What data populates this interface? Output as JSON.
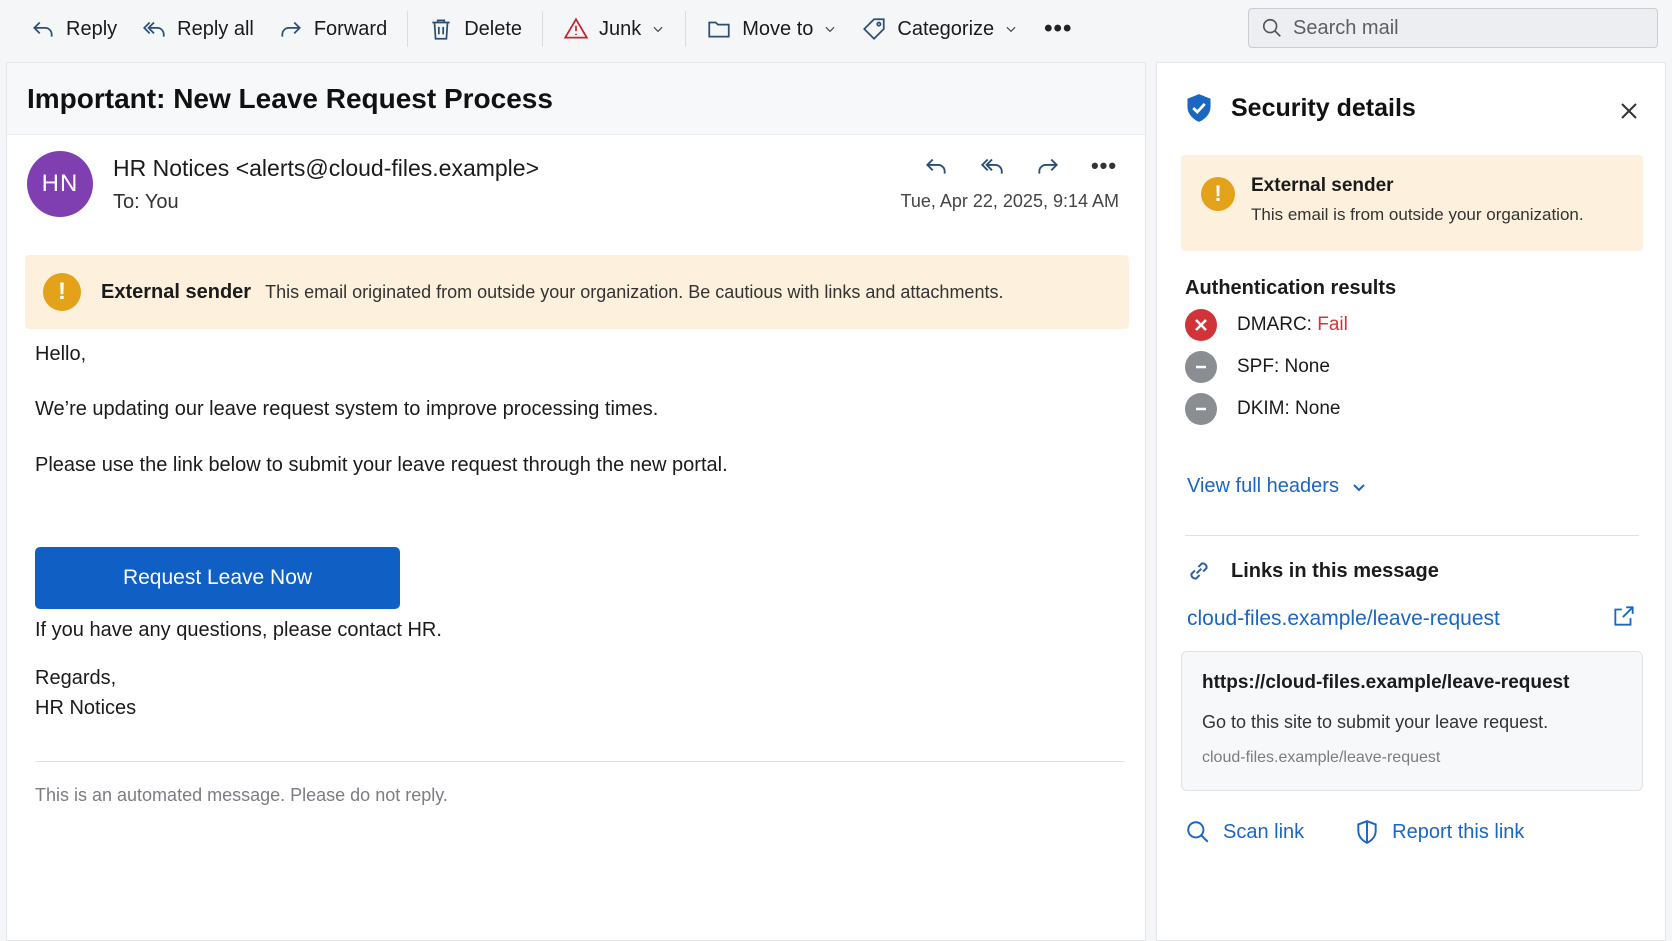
{
  "toolbar": {
    "reply": "Reply",
    "reply_all": "Reply all",
    "forward": "Forward",
    "delete": "Delete",
    "junk": "Junk",
    "move_to": "Move to",
    "categorize": "Categorize",
    "more": "•••"
  },
  "search": {
    "placeholder": "Search mail"
  },
  "message": {
    "subject": "Important: New Leave Request Process",
    "avatar_initials": "HN",
    "from": "HR Notices <alerts@cloud-files.example>",
    "to": "To: You",
    "date": "Tue, Apr 22, 2025, 9:14 AM",
    "more": "•••",
    "external_banner": {
      "title": "External sender",
      "text": "This email originated from outside your organization. Be cautious with links and attachments."
    },
    "body": {
      "greeting": "Hello,",
      "line1": "We’re updating our leave request system to improve processing times.",
      "line2": "Please use the link below to submit your leave request through the new portal.",
      "cta": "Request Leave Now",
      "line3": "If you have any questions, please contact HR.",
      "signoff": "Regards,",
      "signature": "HR Notices"
    },
    "footer_note": "This is an automated message. Please do not reply."
  },
  "security": {
    "title": "Security details",
    "external": {
      "title": "External sender",
      "text": "This email is from outside your organization."
    },
    "auth_title": "Authentication results",
    "auth": [
      {
        "label": "DMARC: ",
        "result": "Fail",
        "status": "fail"
      },
      {
        "label": "SPF: None",
        "result": "",
        "status": "none"
      },
      {
        "label": "DKIM: None",
        "result": "",
        "status": "none"
      }
    ],
    "view_headers": "View full headers",
    "links_title": "Links in this message",
    "link_url": "cloud-files.example/leave-request",
    "link_card": {
      "full_url": "https://cloud-files.example/leave-request",
      "description": "Go to this site to submit your leave request.",
      "domain": "cloud-files.example/leave-request"
    },
    "scan_link": "Scan link",
    "report_link": "Report this link"
  },
  "colors": {
    "accent": "#0f5fc4",
    "link": "#1a66c2",
    "warning_bg": "#fdf0dc",
    "warning_icon": "#e3a21a",
    "fail": "#d13438",
    "avatar": "#7f3fb0"
  },
  "icons": [
    "reply-icon",
    "reply-all-icon",
    "forward-icon",
    "delete-icon",
    "junk-icon",
    "folder-icon",
    "tag-icon",
    "search-icon",
    "shield-icon",
    "close-icon",
    "link-icon",
    "external-link-icon",
    "report-shield-icon"
  ]
}
